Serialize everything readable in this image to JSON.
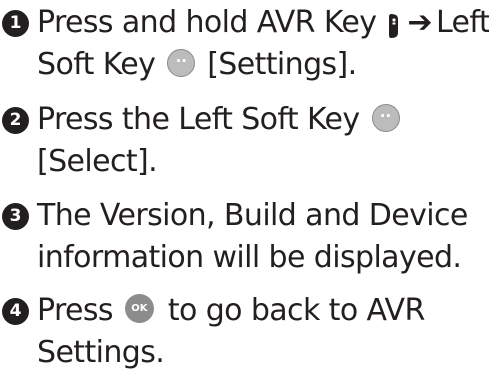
{
  "steps": [
    {
      "number": "1",
      "line1_a": "Press and hold AVR Key",
      "arrow": "➔",
      "line1_b": "Left",
      "line2_a": "Soft Key",
      "line2_b": "[Settings].",
      "avr_icon": "avr-key-icon",
      "softkey_icon": "left-soft-key-icon"
    },
    {
      "number": "2",
      "line1_a": "Press the Left Soft Key",
      "line2_a": "[Select].",
      "softkey_icon": "left-soft-key-icon"
    },
    {
      "number": "3",
      "line1_a": "The Version, Build and Device",
      "line2_a": "information will be displayed."
    },
    {
      "number": "4",
      "line1_a": "Press",
      "ok_label": "OK",
      "line1_b": "to go back to AVR",
      "line2_a": "Settings.",
      "ok_icon": "ok-key-icon"
    }
  ],
  "colors": {
    "text": "#231f20",
    "badge": "#231f20",
    "soft_key": "#bcbcbc",
    "ok_key": "#8c8c8c"
  }
}
